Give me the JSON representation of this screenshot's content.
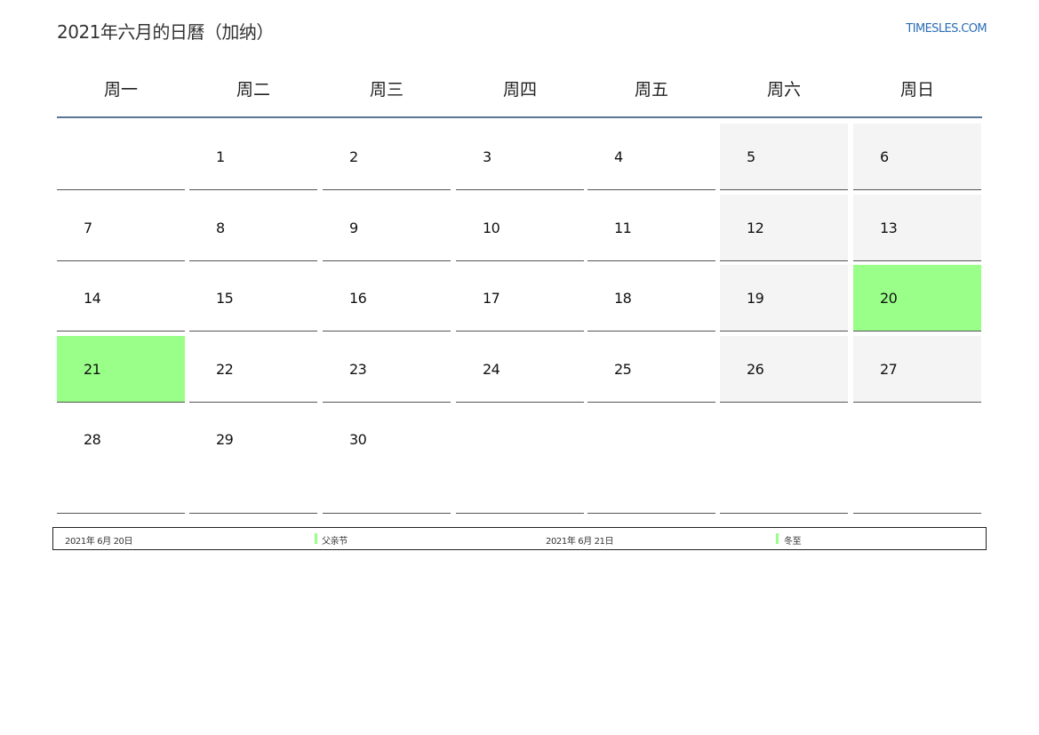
{
  "header": {
    "title": "2021年六月的日曆（加纳）",
    "site": "TIMESLES.COM"
  },
  "weekdays": [
    "周一",
    "周二",
    "周三",
    "周四",
    "周五",
    "周六",
    "周日"
  ],
  "weeks": [
    [
      {
        "day": ""
      },
      {
        "day": "1"
      },
      {
        "day": "2"
      },
      {
        "day": "3"
      },
      {
        "day": "4"
      },
      {
        "day": "5",
        "type": "weekend"
      },
      {
        "day": "6",
        "type": "weekend"
      }
    ],
    [
      {
        "day": "7"
      },
      {
        "day": "8"
      },
      {
        "day": "9"
      },
      {
        "day": "10"
      },
      {
        "day": "11"
      },
      {
        "day": "12",
        "type": "weekend"
      },
      {
        "day": "13",
        "type": "weekend"
      }
    ],
    [
      {
        "day": "14"
      },
      {
        "day": "15"
      },
      {
        "day": "16"
      },
      {
        "day": "17"
      },
      {
        "day": "18"
      },
      {
        "day": "19",
        "type": "weekend"
      },
      {
        "day": "20",
        "type": "holiday"
      }
    ],
    [
      {
        "day": "21",
        "type": "holiday"
      },
      {
        "day": "22"
      },
      {
        "day": "23"
      },
      {
        "day": "24"
      },
      {
        "day": "25"
      },
      {
        "day": "26",
        "type": "weekend"
      },
      {
        "day": "27",
        "type": "weekend"
      }
    ],
    [
      {
        "day": "28"
      },
      {
        "day": "29"
      },
      {
        "day": "30"
      },
      {
        "day": "",
        "type": "blank"
      },
      {
        "day": "",
        "type": "blank"
      },
      {
        "day": "",
        "type": "blank"
      },
      {
        "day": "",
        "type": "blank"
      }
    ]
  ],
  "holiday_color": "#99ff88",
  "weekend_color": "#f4f4f4",
  "legend": [
    {
      "date": "2021年 6月 20日",
      "name": "父亲节"
    },
    {
      "date": "2021年 6月 21日",
      "name": "冬至"
    }
  ]
}
